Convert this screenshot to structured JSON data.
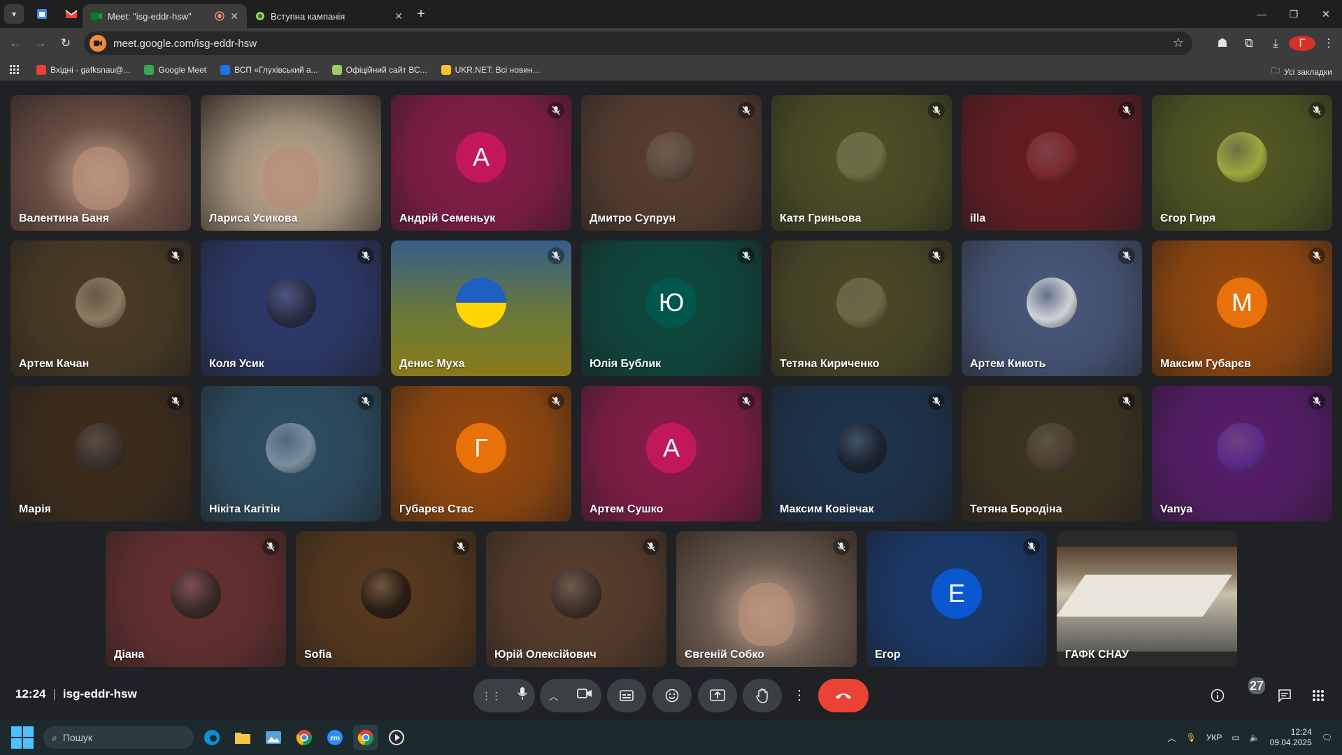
{
  "browser": {
    "tabs": [
      {
        "title": "Meet: \"isg-eddr-hsw\"",
        "active": true
      },
      {
        "title": "Вступна кампанія",
        "active": false
      }
    ],
    "url": "meet.google.com/isg-eddr-hsw",
    "profile_initial": "Г",
    "bookmarks": [
      {
        "label": "Вхідні - gafksnau@...",
        "color": "#ea4335"
      },
      {
        "label": "Google Meet",
        "color": "#34a853"
      },
      {
        "label": "ВСП «Глухівський а...",
        "color": "#1a73e8"
      },
      {
        "label": "Офіційний сайт ВС...",
        "color": "#9ccc65"
      },
      {
        "label": "UKR.NET: Всі новин...",
        "color": "#fbc02d"
      }
    ],
    "all_bookmarks_label": "Усі закладки"
  },
  "participants": [
    {
      "name": "Валентина Баня",
      "type": "video",
      "bg": "#6b4f45",
      "muted": false
    },
    {
      "name": "Лариса Усикова",
      "type": "video",
      "bg": "#9e8f7a",
      "muted": false
    },
    {
      "name": "Андрій Семеньук",
      "type": "letter",
      "letter": "A",
      "avatar_color": "#c2185b",
      "bg": "#8a1c48",
      "muted": true
    },
    {
      "name": "Дмитро Супрун",
      "type": "photo",
      "avatar_color": "#5d4a3e",
      "bg": "#5a3f30",
      "muted": true
    },
    {
      "name": "Катя Гриньова",
      "type": "photo",
      "avatar_color": "#6b6e43",
      "bg": "#4f5125",
      "muted": true
    },
    {
      "name": "illa",
      "type": "photo",
      "avatar_color": "#7a2a30",
      "bg": "#6a1c22",
      "muted": true
    },
    {
      "name": "Єгор Гиря",
      "type": "photo",
      "avatar_color": "#9ea83e",
      "bg": "#545a22",
      "muted": true
    },
    {
      "name": "Артем Качан",
      "type": "photo",
      "avatar_color": "#8d7a62",
      "bg": "#4c3c24",
      "muted": true
    },
    {
      "name": "Коля Усик",
      "type": "photo",
      "avatar_color": "#2a2d45",
      "bg": "#2d3a6e",
      "muted": true
    },
    {
      "name": "Денис Муха",
      "type": "flag",
      "bg": "#3f5a5a",
      "muted": true
    },
    {
      "name": "Юлія Бублик",
      "type": "letter",
      "letter": "Ю",
      "avatar_color": "#00574b",
      "bg": "#0c4a3e",
      "muted": true
    },
    {
      "name": "Тетяна Кириченко",
      "type": "photo",
      "avatar_color": "#6e6644",
      "bg": "#4d4a26",
      "muted": true
    },
    {
      "name": "Артем Кикоть",
      "type": "photo",
      "avatar_color": "#cfd2d6",
      "bg": "#4a5a7e",
      "muted": true
    },
    {
      "name": "Максим Губарєв",
      "type": "letter",
      "letter": "M",
      "avatar_color": "#e8710a",
      "bg": "#9a4a0c",
      "muted": true
    },
    {
      "name": "Марія",
      "type": "photo",
      "avatar_color": "#3a302a",
      "bg": "#3e2c1a",
      "muted": true
    },
    {
      "name": "Нікіта Кагітін",
      "type": "photo",
      "avatar_color": "#7a8ea0",
      "bg": "#2e5066",
      "muted": true
    },
    {
      "name": "Губарєв Стас",
      "type": "letter",
      "letter": "Г",
      "avatar_color": "#e8710a",
      "bg": "#9a4a0c",
      "muted": true
    },
    {
      "name": "Артем Сушко",
      "type": "letter",
      "letter": "A",
      "avatar_color": "#c2185b",
      "bg": "#8a1c48",
      "muted": true
    },
    {
      "name": "Максим Ковівчак",
      "type": "photo",
      "avatar_color": "#1c2430",
      "bg": "#1e3450",
      "muted": true
    },
    {
      "name": "Тетяна Бородіна",
      "type": "photo",
      "avatar_color": "#4a3e30",
      "bg": "#3e3420",
      "muted": true
    },
    {
      "name": "Vanya",
      "type": "photo",
      "avatar_color": "#5a2a8a",
      "bg": "#5a1c6e",
      "muted": true
    },
    {
      "name": "Діана",
      "type": "photo",
      "avatar_color": "#3a2a28",
      "bg": "#6a3030",
      "muted": true
    },
    {
      "name": "Sofia",
      "type": "photo",
      "avatar_color": "#2a1e14",
      "bg": "#5a3a1c",
      "muted": true
    },
    {
      "name": "Юрій Олексійович",
      "type": "photo",
      "avatar_color": "#3e3028",
      "bg": "#5a3e2c",
      "muted": true
    },
    {
      "name": "Євгеній Собко",
      "type": "video",
      "bg": "#6a5a50",
      "muted": true,
      "selected": true
    },
    {
      "name": "Егор",
      "type": "letter",
      "letter": "E",
      "avatar_color": "#0b57d0",
      "bg": "#1a3a6e",
      "muted": true
    },
    {
      "name": "ГАФК СНАУ",
      "type": "room",
      "bg": "#4a4a44",
      "muted": false
    }
  ],
  "meeting": {
    "time": "12:24",
    "code": "isg-eddr-hsw",
    "participant_count": "27"
  },
  "taskbar": {
    "search_placeholder": "Пошук",
    "language": "УКР",
    "time": "12:24",
    "date": "09.04.2025"
  }
}
